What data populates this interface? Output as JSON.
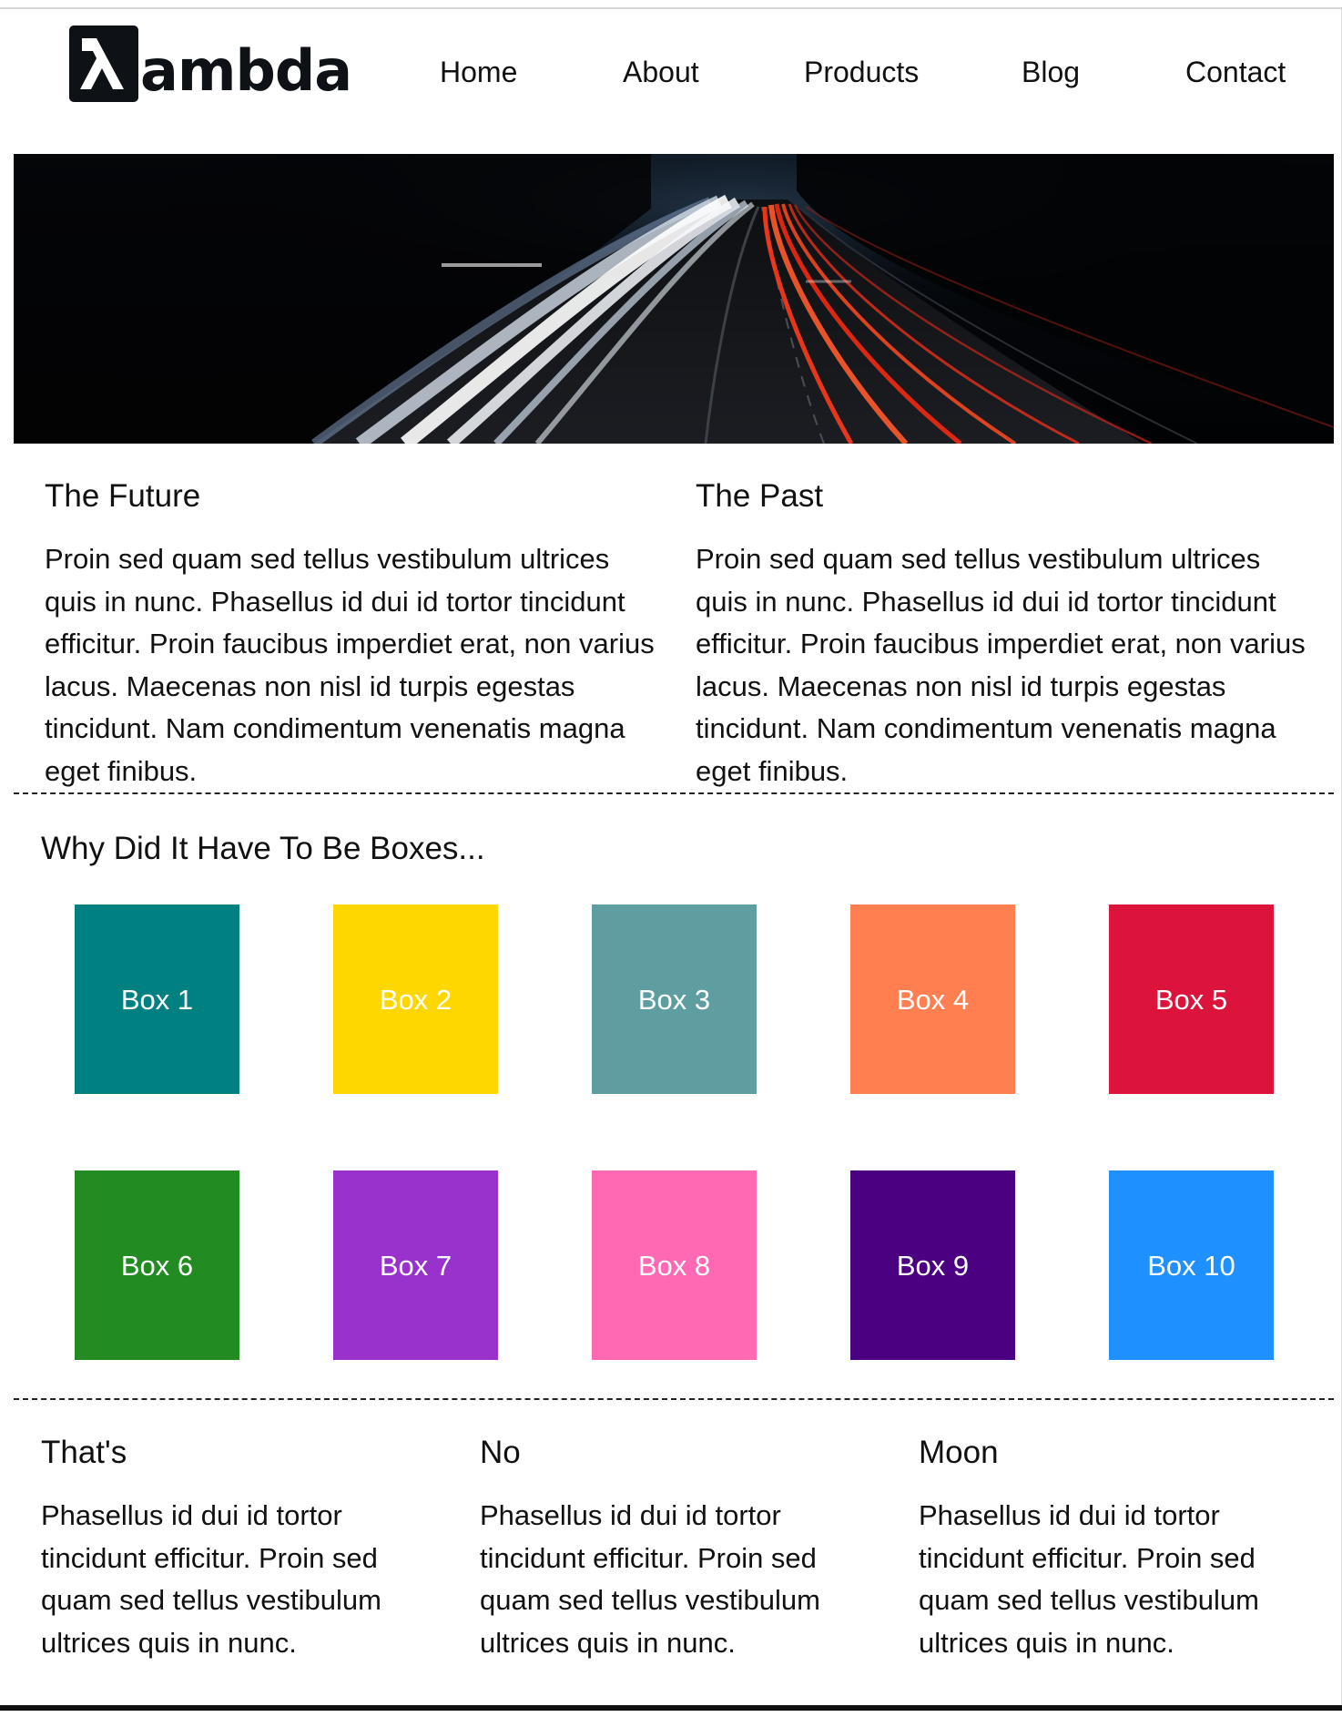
{
  "header": {
    "logo_text": "ambda",
    "logo_glyph": "λ",
    "nav": [
      {
        "label": "Home"
      },
      {
        "label": "About"
      },
      {
        "label": "Products"
      },
      {
        "label": "Blog"
      },
      {
        "label": "Contact"
      }
    ]
  },
  "hero": {
    "image": "night-highway-light-trails"
  },
  "intro": [
    {
      "title": "The Future",
      "body": "Proin sed quam sed tellus vestibulum ultrices quis in nunc. Phasellus id dui id tortor tincidunt efficitur. Proin faucibus imperdiet erat, non varius lacus. Maecenas non nisl id turpis egestas tincidunt. Nam condimentum venenatis magna eget finibus."
    },
    {
      "title": "The Past",
      "body": "Proin sed quam sed tellus vestibulum ultrices quis in nunc. Phasellus id dui id tortor tincidunt efficitur. Proin faucibus imperdiet erat, non varius lacus. Maecenas non nisl id turpis egestas tincidunt. Nam condimentum venenatis magna eget finibus."
    }
  ],
  "boxes": {
    "title": "Why Did It Have To Be Boxes...",
    "items": [
      {
        "label": "Box 1",
        "color": "#008080"
      },
      {
        "label": "Box 2",
        "color": "#FFD700"
      },
      {
        "label": "Box 3",
        "color": "#5F9EA0"
      },
      {
        "label": "Box 4",
        "color": "#FF7F50"
      },
      {
        "label": "Box 5",
        "color": "#DC143C"
      },
      {
        "label": "Box 6",
        "color": "#228B22"
      },
      {
        "label": "Box 7",
        "color": "#9932CC"
      },
      {
        "label": "Box 8",
        "color": "#FF69B4"
      },
      {
        "label": "Box 9",
        "color": "#4B0082"
      },
      {
        "label": "Box 10",
        "color": "#1E90FF"
      }
    ]
  },
  "bottom": [
    {
      "title": "That's",
      "body": "Phasellus id dui id tortor tincidunt efficitur. Proin sed quam sed tellus vestibulum ultrices quis in nunc."
    },
    {
      "title": "No",
      "body": "Phasellus id dui id tortor tincidunt efficitur. Proin sed quam sed tellus vestibulum ultrices quis in nunc."
    },
    {
      "title": "Moon",
      "body": "Phasellus id dui id tortor tincidunt efficitur. Proin sed quam sed tellus vestibulum ultrices quis in nunc."
    }
  ]
}
